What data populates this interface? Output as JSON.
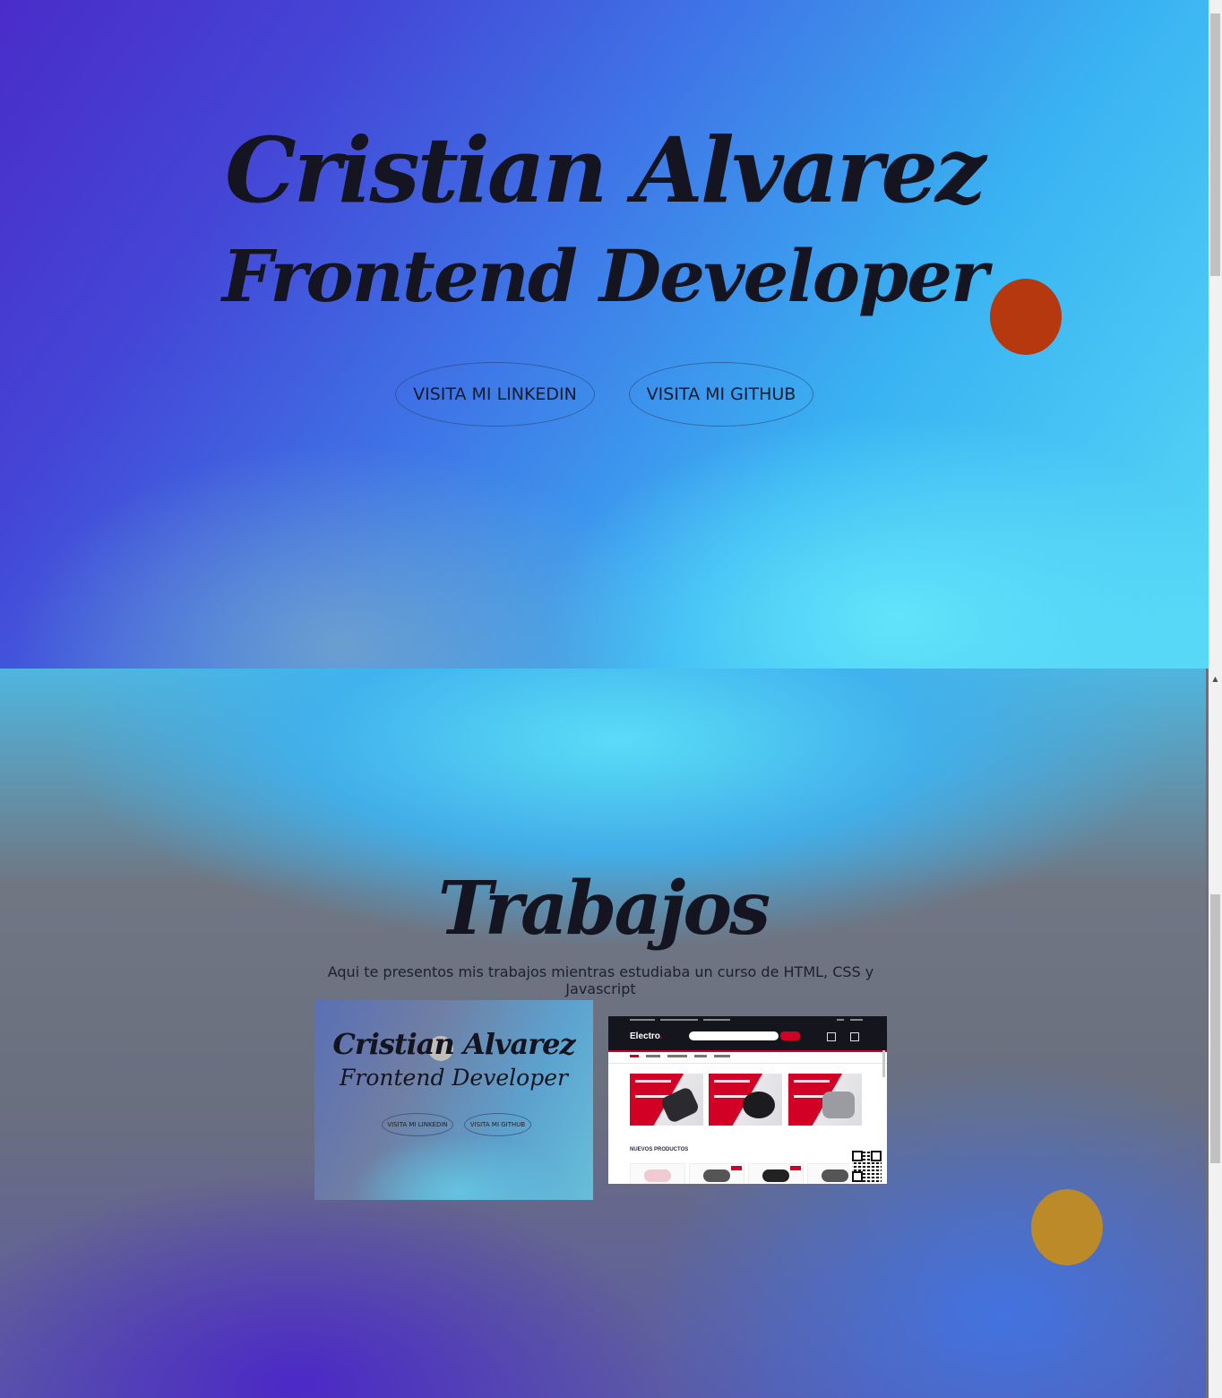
{
  "hero": {
    "name": "Cristian Alvarez",
    "role": "Frontend Developer",
    "linkedin_button": "VISITA MI LINKEDIN",
    "github_button": "VISITA MI GITHUB"
  },
  "works": {
    "title": "Trabajos",
    "description": "Aqui te presentos mis trabajos mientras estudiaba un curso de HTML, CSS y Javascript",
    "projects": [
      {
        "name": "Cristian Alvarez",
        "role": "Frontend Developer",
        "button_1": "VISITA MI LINKEDIN",
        "button_2": "VISITA MI GITHUB"
      },
      {
        "logo": "Electro",
        "logo_dot": ".",
        "section_label": "NUEVOS PRODUCTOS"
      }
    ]
  },
  "colors": {
    "accent_red_dot": "#b5380e",
    "accent_gold_dot": "#bd8a2a",
    "electro_red": "#d10024"
  },
  "icons": {
    "scroll_up": "triangle-up-icon"
  }
}
